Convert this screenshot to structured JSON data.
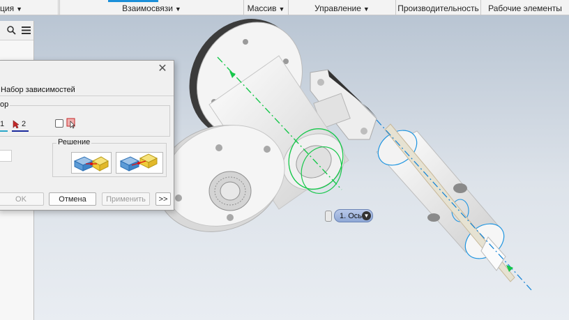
{
  "ribbon": {
    "groups": [
      {
        "label": "ция",
        "dropdown": true
      },
      {
        "label": "",
        "dropdown": false
      },
      {
        "label": "Взаимосвязи",
        "dropdown": true
      },
      {
        "label": "Массив",
        "dropdown": true
      },
      {
        "label": "Управление",
        "dropdown": true
      },
      {
        "label": "Производительность",
        "dropdown": false
      },
      {
        "label": "Рабочие элементы",
        "dropdown": false
      }
    ],
    "active_color": "#1c8fd9"
  },
  "browser": {
    "icons": [
      "search-icon",
      "menu-icon"
    ]
  },
  "dialog": {
    "tab_label": "Набор зависимостей",
    "selection_group_label": "ор",
    "selection1_label": "1",
    "selection2_label": "2",
    "solution_label": "Решение",
    "ok_label": "OK",
    "cancel_label": "Отмена",
    "apply_label": "Применить",
    "expand_label": ">>",
    "colors": {
      "selection1": "#2aa6c9",
      "selection2": "#1a2a9c"
    }
  },
  "viewport": {
    "axis_tag_label": "1. Ось",
    "colors": {
      "axis_green": "#16c74a",
      "axis_blue": "#1a86d6",
      "part": "#f2f2f2",
      "ring": "#1f95e0"
    }
  }
}
